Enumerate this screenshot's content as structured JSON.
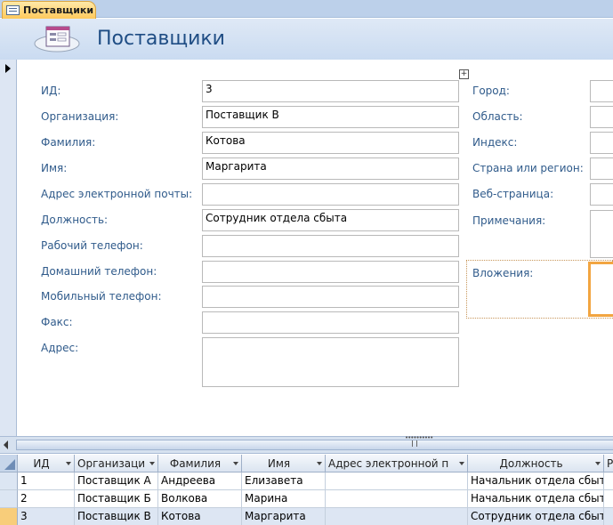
{
  "tab": {
    "label": "Поставщики",
    "icon": "form-icon"
  },
  "header": {
    "title": "Поставщики",
    "icon": "form-icon"
  },
  "form": {
    "left": [
      {
        "name": "id",
        "label": "ИД:",
        "value": "3"
      },
      {
        "name": "company",
        "label": "Организация:",
        "value": "Поставщик В"
      },
      {
        "name": "last-name",
        "label": "Фамилия:",
        "value": "Котова"
      },
      {
        "name": "first-name",
        "label": "Имя:",
        "value": "Маргарита"
      },
      {
        "name": "email",
        "label": "Адрес электронной почты:",
        "value": ""
      },
      {
        "name": "job-title",
        "label": "Должность:",
        "value": "Сотрудник отдела сбыта"
      },
      {
        "name": "business-phone",
        "label": "Рабочий телефон:",
        "value": ""
      },
      {
        "name": "home-phone",
        "label": "Домашний телефон:",
        "value": ""
      },
      {
        "name": "mobile-phone",
        "label": "Мобильный телефон:",
        "value": ""
      },
      {
        "name": "fax",
        "label": "Факс:",
        "value": ""
      },
      {
        "name": "address",
        "label": "Адрес:",
        "value": ""
      }
    ],
    "right": [
      {
        "name": "city",
        "label": "Город:",
        "value": ""
      },
      {
        "name": "region",
        "label": "Область:",
        "value": ""
      },
      {
        "name": "zip",
        "label": "Индекс:",
        "value": ""
      },
      {
        "name": "country",
        "label": "Страна или регион:",
        "value": ""
      },
      {
        "name": "web-page",
        "label": "Веб-страница:",
        "value": ""
      },
      {
        "name": "notes",
        "label": "Примечания:",
        "value": ""
      },
      {
        "name": "attachments",
        "label": "Вложения:",
        "value": ""
      }
    ]
  },
  "datasheet": {
    "columns": [
      "ИД",
      "Организаци",
      "Фамилия",
      "Имя",
      "Адрес электронной п",
      "Должность",
      "Р"
    ],
    "rows": [
      [
        "1",
        "Поставщик А",
        "Андреева",
        "Елизавета",
        "",
        "Начальник отдела сбыт"
      ],
      [
        "2",
        "Поставщик Б",
        "Волкова",
        "Марина",
        "",
        "Начальник отдела сбыт"
      ],
      [
        "3",
        "Поставщик В",
        "Котова",
        "Маргарита",
        "",
        "Сотрудник отдела сбыт"
      ]
    ],
    "current_row": 3
  },
  "colors": {
    "accent": "#1f4d84",
    "label": "#305b8b",
    "tab": "#ffc95c",
    "current_row": "#f8cd7a"
  }
}
